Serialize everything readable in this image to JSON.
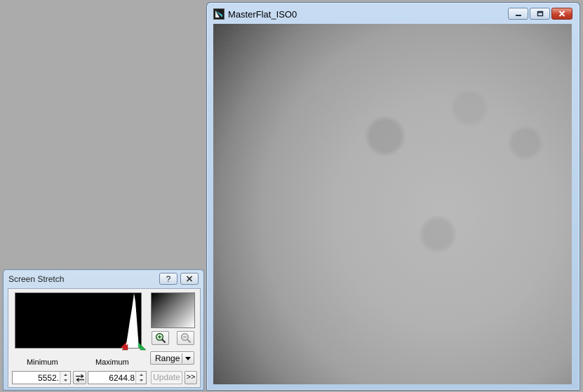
{
  "image_window": {
    "title": "MasterFlat_ISO0",
    "icons": {
      "app": "app-logo-icon",
      "minimize": "minimize-icon",
      "restore": "restore-icon",
      "close": "close-icon"
    },
    "colors": {
      "close_button": "#c8432c",
      "titlebar": "#c7dcf2"
    }
  },
  "screen_stretch": {
    "title": "Screen Stretch",
    "help_label": "?",
    "minimum_label": "Minimum",
    "maximum_label": "Maximum",
    "minimum_value": "5552.",
    "maximum_value": "6244.8",
    "range_label": "Range",
    "update_label": "Update",
    "more_label": ">>",
    "icons": {
      "close": "close-icon",
      "zoom_in": "zoom-in-icon",
      "zoom_out": "zoom-out-icon",
      "swap": "swap-arrows-icon",
      "range_dropdown": "chevron-down-icon",
      "min_marker": "min-marker-icon",
      "max_marker": "max-marker-icon"
    },
    "colors": {
      "min_marker": "#d42020",
      "max_marker": "#22b84a"
    }
  }
}
